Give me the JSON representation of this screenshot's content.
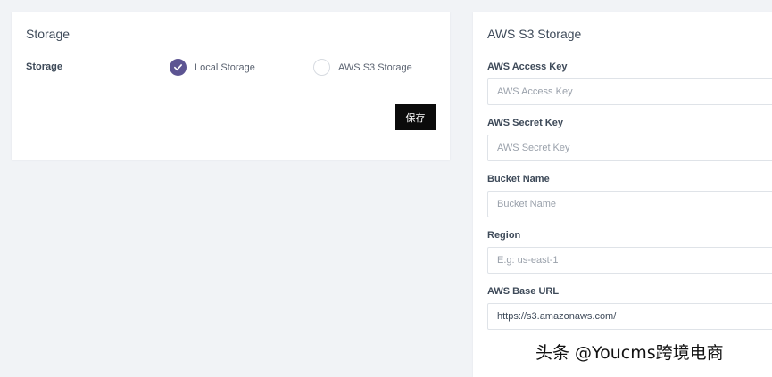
{
  "storage_panel": {
    "title": "Storage",
    "field_label": "Storage",
    "options": [
      {
        "label": "Local Storage",
        "selected": true
      },
      {
        "label": "AWS S3 Storage",
        "selected": false
      }
    ],
    "save_label": "保存"
  },
  "s3_panel": {
    "title": "AWS S3 Storage",
    "fields": {
      "access_key": {
        "label": "AWS Access Key",
        "placeholder": "AWS Access Key",
        "value": ""
      },
      "secret_key": {
        "label": "AWS Secret Key",
        "placeholder": "AWS Secret Key",
        "value": ""
      },
      "bucket": {
        "label": "Bucket Name",
        "placeholder": "Bucket Name",
        "value": ""
      },
      "region": {
        "label": "Region",
        "placeholder": "E.g: us-east-1",
        "value": ""
      },
      "base_url": {
        "label": "AWS Base URL",
        "placeholder": "",
        "value": "https://s3.amazonaws.com/"
      }
    }
  },
  "watermark": "头条 @Youcms跨境电商",
  "colors": {
    "page_background": "#f1f3f6",
    "radio_checked": "#5c5492",
    "save_button": "#0b0b0b"
  },
  "icons": {
    "radio_checked": "checkmark-icon"
  }
}
